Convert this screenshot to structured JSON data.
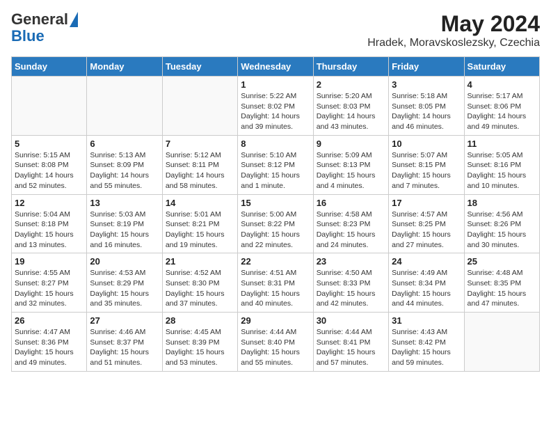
{
  "header": {
    "logo_line1": "General",
    "logo_line2": "Blue",
    "title": "May 2024",
    "subtitle": "Hradek, Moravskoslezsky, Czechia"
  },
  "days_of_week": [
    "Sunday",
    "Monday",
    "Tuesday",
    "Wednesday",
    "Thursday",
    "Friday",
    "Saturday"
  ],
  "weeks": [
    [
      {
        "day": "",
        "info": ""
      },
      {
        "day": "",
        "info": ""
      },
      {
        "day": "",
        "info": ""
      },
      {
        "day": "1",
        "info": "Sunrise: 5:22 AM\nSunset: 8:02 PM\nDaylight: 14 hours and 39 minutes."
      },
      {
        "day": "2",
        "info": "Sunrise: 5:20 AM\nSunset: 8:03 PM\nDaylight: 14 hours and 43 minutes."
      },
      {
        "day": "3",
        "info": "Sunrise: 5:18 AM\nSunset: 8:05 PM\nDaylight: 14 hours and 46 minutes."
      },
      {
        "day": "4",
        "info": "Sunrise: 5:17 AM\nSunset: 8:06 PM\nDaylight: 14 hours and 49 minutes."
      }
    ],
    [
      {
        "day": "5",
        "info": "Sunrise: 5:15 AM\nSunset: 8:08 PM\nDaylight: 14 hours and 52 minutes."
      },
      {
        "day": "6",
        "info": "Sunrise: 5:13 AM\nSunset: 8:09 PM\nDaylight: 14 hours and 55 minutes."
      },
      {
        "day": "7",
        "info": "Sunrise: 5:12 AM\nSunset: 8:11 PM\nDaylight: 14 hours and 58 minutes."
      },
      {
        "day": "8",
        "info": "Sunrise: 5:10 AM\nSunset: 8:12 PM\nDaylight: 15 hours and 1 minute."
      },
      {
        "day": "9",
        "info": "Sunrise: 5:09 AM\nSunset: 8:13 PM\nDaylight: 15 hours and 4 minutes."
      },
      {
        "day": "10",
        "info": "Sunrise: 5:07 AM\nSunset: 8:15 PM\nDaylight: 15 hours and 7 minutes."
      },
      {
        "day": "11",
        "info": "Sunrise: 5:05 AM\nSunset: 8:16 PM\nDaylight: 15 hours and 10 minutes."
      }
    ],
    [
      {
        "day": "12",
        "info": "Sunrise: 5:04 AM\nSunset: 8:18 PM\nDaylight: 15 hours and 13 minutes."
      },
      {
        "day": "13",
        "info": "Sunrise: 5:03 AM\nSunset: 8:19 PM\nDaylight: 15 hours and 16 minutes."
      },
      {
        "day": "14",
        "info": "Sunrise: 5:01 AM\nSunset: 8:21 PM\nDaylight: 15 hours and 19 minutes."
      },
      {
        "day": "15",
        "info": "Sunrise: 5:00 AM\nSunset: 8:22 PM\nDaylight: 15 hours and 22 minutes."
      },
      {
        "day": "16",
        "info": "Sunrise: 4:58 AM\nSunset: 8:23 PM\nDaylight: 15 hours and 24 minutes."
      },
      {
        "day": "17",
        "info": "Sunrise: 4:57 AM\nSunset: 8:25 PM\nDaylight: 15 hours and 27 minutes."
      },
      {
        "day": "18",
        "info": "Sunrise: 4:56 AM\nSunset: 8:26 PM\nDaylight: 15 hours and 30 minutes."
      }
    ],
    [
      {
        "day": "19",
        "info": "Sunrise: 4:55 AM\nSunset: 8:27 PM\nDaylight: 15 hours and 32 minutes."
      },
      {
        "day": "20",
        "info": "Sunrise: 4:53 AM\nSunset: 8:29 PM\nDaylight: 15 hours and 35 minutes."
      },
      {
        "day": "21",
        "info": "Sunrise: 4:52 AM\nSunset: 8:30 PM\nDaylight: 15 hours and 37 minutes."
      },
      {
        "day": "22",
        "info": "Sunrise: 4:51 AM\nSunset: 8:31 PM\nDaylight: 15 hours and 40 minutes."
      },
      {
        "day": "23",
        "info": "Sunrise: 4:50 AM\nSunset: 8:33 PM\nDaylight: 15 hours and 42 minutes."
      },
      {
        "day": "24",
        "info": "Sunrise: 4:49 AM\nSunset: 8:34 PM\nDaylight: 15 hours and 44 minutes."
      },
      {
        "day": "25",
        "info": "Sunrise: 4:48 AM\nSunset: 8:35 PM\nDaylight: 15 hours and 47 minutes."
      }
    ],
    [
      {
        "day": "26",
        "info": "Sunrise: 4:47 AM\nSunset: 8:36 PM\nDaylight: 15 hours and 49 minutes."
      },
      {
        "day": "27",
        "info": "Sunrise: 4:46 AM\nSunset: 8:37 PM\nDaylight: 15 hours and 51 minutes."
      },
      {
        "day": "28",
        "info": "Sunrise: 4:45 AM\nSunset: 8:39 PM\nDaylight: 15 hours and 53 minutes."
      },
      {
        "day": "29",
        "info": "Sunrise: 4:44 AM\nSunset: 8:40 PM\nDaylight: 15 hours and 55 minutes."
      },
      {
        "day": "30",
        "info": "Sunrise: 4:44 AM\nSunset: 8:41 PM\nDaylight: 15 hours and 57 minutes."
      },
      {
        "day": "31",
        "info": "Sunrise: 4:43 AM\nSunset: 8:42 PM\nDaylight: 15 hours and 59 minutes."
      },
      {
        "day": "",
        "info": ""
      }
    ]
  ]
}
